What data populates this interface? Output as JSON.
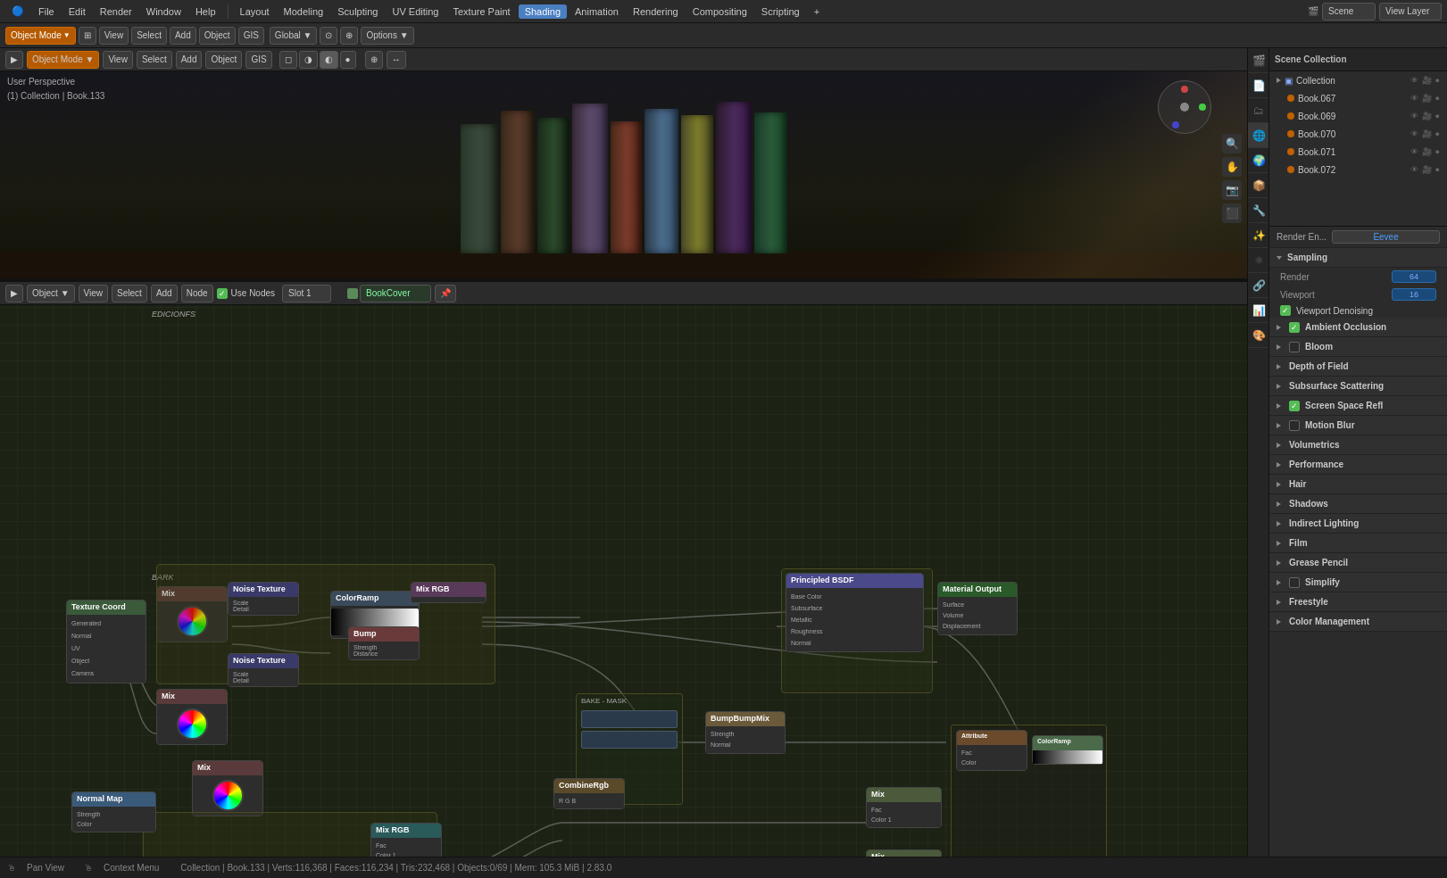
{
  "app": {
    "title": "Blender 2.83"
  },
  "topmenu": {
    "items": [
      "Blender",
      "File",
      "Edit",
      "Render",
      "Window",
      "Help"
    ],
    "workspace_tabs": [
      "Layout",
      "Modeling",
      "Sculpting",
      "UV Editing",
      "Texture Paint",
      "Shading",
      "Animation",
      "Rendering",
      "Compositing",
      "Scripting"
    ],
    "active_workspace": "Shading"
  },
  "toolbar": {
    "mode_label": "Object Mode",
    "view_label": "View",
    "select_label": "Select",
    "add_label": "Add",
    "object_label": "Object",
    "gis_label": "GIS"
  },
  "viewport": {
    "info_line1": "User Perspective",
    "info_line2": "(1) Collection | Book.133"
  },
  "node_editor": {
    "header": {
      "mode": "Object",
      "view": "View",
      "select": "Select",
      "add": "Add",
      "node": "Node",
      "use_nodes": "Use Nodes",
      "slot": "Slot 1",
      "material": "BookCover"
    },
    "label": "BookCover"
  },
  "outliner": {
    "title": "Scene Collection",
    "items": [
      {
        "label": "Collection",
        "type": "collection",
        "indent": 0
      },
      {
        "label": "Book.067",
        "type": "object",
        "indent": 1
      },
      {
        "label": "Book.069",
        "type": "object",
        "indent": 1
      },
      {
        "label": "Book.070",
        "type": "object",
        "indent": 1
      },
      {
        "label": "Book.071",
        "type": "object",
        "indent": 1
      },
      {
        "label": "Book.072",
        "type": "object",
        "indent": 1
      }
    ]
  },
  "properties": {
    "scene_label": "Scene",
    "render_engine_label": "Render En...",
    "render_engine_value": "Eevee",
    "sections": [
      {
        "label": "Sampling",
        "expanded": true
      },
      {
        "label": "Ambient Occlusion",
        "has_checkbox": true,
        "checked": true
      },
      {
        "label": "Bloom",
        "has_checkbox": true,
        "checked": false
      },
      {
        "label": "Depth of Field",
        "expanded": false
      },
      {
        "label": "Subsurface Scattering",
        "expanded": false
      },
      {
        "label": "Screen Space Refl",
        "has_checkbox": true,
        "checked": true
      },
      {
        "label": "Motion Blur",
        "has_checkbox": true,
        "checked": false
      },
      {
        "label": "Volumetrics",
        "expanded": false
      },
      {
        "label": "Performance",
        "expanded": false
      },
      {
        "label": "Hair",
        "expanded": false
      },
      {
        "label": "Shadows",
        "expanded": false
      },
      {
        "label": "Indirect Lighting",
        "expanded": false
      },
      {
        "label": "Film",
        "expanded": false
      },
      {
        "label": "Grease Pencil",
        "expanded": false
      },
      {
        "label": "Simplify",
        "has_checkbox": true,
        "checked": false
      },
      {
        "label": "Freestyle",
        "expanded": false
      },
      {
        "label": "Color Management",
        "expanded": false
      }
    ],
    "sampling": {
      "render_label": "Render",
      "render_value": "64",
      "viewport_label": "Viewport",
      "viewport_value": "16"
    },
    "viewport_denoising_label": "Viewport Denoising"
  },
  "statusbar": {
    "pan_view": "Pan View",
    "context_menu": "Context Menu",
    "stats": "Collection | Book.133 | Verts:116,368 | Faces:116,234 | Tris:232,468 | Objects:0/69 | Mem: 105.3 MiB | 2.83.0"
  }
}
